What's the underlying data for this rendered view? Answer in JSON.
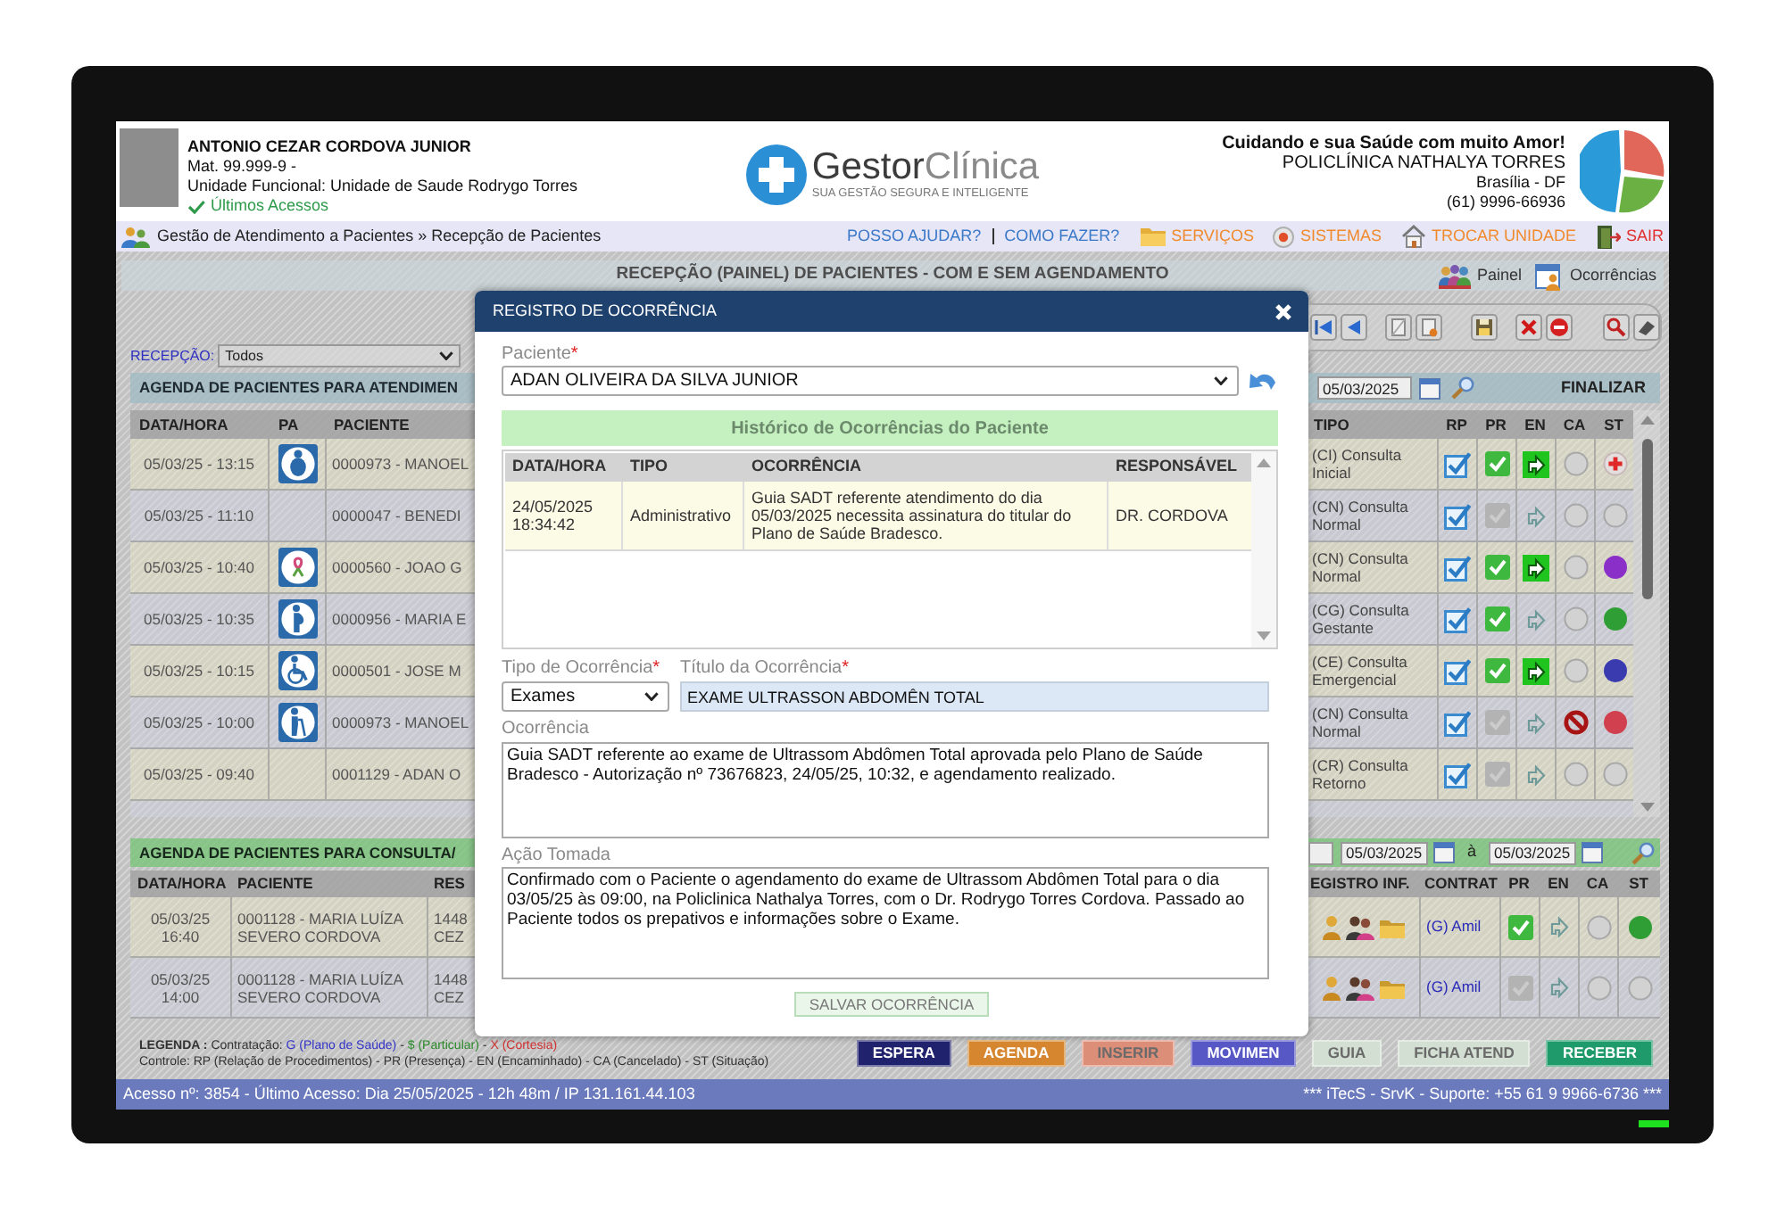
{
  "header": {
    "user": {
      "name": "ANTONIO CEZAR CORDOVA JUNIOR",
      "registration": "Mat. 99.999-9 -",
      "unit": "Unidade Funcional: Unidade de Saude Rodrygo Torres",
      "recent_access": "Últimos Acessos"
    },
    "logo": {
      "name": "**Gestor**Clínica",
      "tagline": "SUA GESTÃO SEGURA E INTELIGENTE"
    },
    "clinic": {
      "slogan": "Cuidando e sua Saúde com muito Amor!",
      "name": "POLICLÍNICA NATHALYA TORRES",
      "city": "Brasília - DF",
      "phone": "(61) 9996-66936"
    }
  },
  "nav": {
    "breadcrumb": "Gestão de Atendimento a Pacientes » Recepção de Pacientes",
    "help_links": [
      "POSSO AJUDAR?",
      "COMO FAZER?"
    ],
    "menu": [
      {
        "label": "SERVIÇOS",
        "kind": "services"
      },
      {
        "label": "SISTEMAS",
        "kind": "systems"
      },
      {
        "label": "TROCAR UNIDADE",
        "kind": "switch_unit"
      },
      {
        "label": "SAIR",
        "kind": "exit"
      }
    ]
  },
  "page": {
    "title": "RECEPÇÃO (PAINEL) DE PACIENTES - COM E SEM AGENDAMENTO",
    "shortcuts": [
      {
        "label": "Painel",
        "kind": "panel"
      },
      {
        "label": "Ocorrências",
        "kind": "occurrences"
      }
    ]
  },
  "reception_filter": {
    "label": "RECEPÇÃO:",
    "value": "Todos"
  },
  "attendance": {
    "title": "AGENDA DE PACIENTES PARA ATENDIMEN",
    "date": "05/03/2025",
    "finalize": "FINALIZAR",
    "columns": [
      "DATA/HORA",
      "PA",
      "PACIENTE",
      "TIPO",
      "RP",
      "PR",
      "EN",
      "CA",
      "ST"
    ],
    "rows": [
      {
        "datetime": "05/03/25 - 13:15",
        "pa": {
          "kind": "obese"
        },
        "patient": "0000973 - MANOEL",
        "type": "(CI) Consulta Inicial",
        "rp": true,
        "present": true,
        "forwarded": true,
        "cancelled": false,
        "status": {
          "kind": "cross"
        }
      },
      {
        "datetime": "05/03/25 - 11:10",
        "patient": "0000047 - BENEDI",
        "type": "(CN) Consulta Normal",
        "rp": true,
        "present": false,
        "forwarded": false,
        "cancelled": false,
        "status": {
          "kind": "empty"
        }
      },
      {
        "datetime": "05/03/25 - 10:40",
        "pa": {
          "kind": "ribbon"
        },
        "patient": "0000560 - JOAO G",
        "type": "(CN) Consulta Normal",
        "rp": true,
        "present": true,
        "forwarded": true,
        "cancelled": false,
        "status": {
          "kind": "dot",
          "color": "#8b2fc9"
        }
      },
      {
        "datetime": "05/03/25 - 10:35",
        "pa": {
          "kind": "pregnant"
        },
        "patient": "0000956 - MARIA E",
        "type": "(CG) Consulta Gestante",
        "rp": true,
        "present": true,
        "forwarded": false,
        "cancelled": false,
        "status": {
          "kind": "dot",
          "color": "#2f9e34"
        }
      },
      {
        "datetime": "05/03/25 - 10:15",
        "pa": {
          "kind": "wheelchair"
        },
        "patient": "0000501 - JOSE M",
        "type": "(CE) Consulta Emergencial",
        "rp": true,
        "present": true,
        "forwarded": true,
        "cancelled": false,
        "status": {
          "kind": "dot",
          "color": "#3b3bb0"
        }
      },
      {
        "datetime": "05/03/25 - 10:00",
        "pa": {
          "kind": "elderly"
        },
        "patient": "0000973 - MANOEL",
        "type": "(CN) Consulta Normal",
        "rp": true,
        "present": false,
        "forwarded": false,
        "cancelled": true,
        "status": {
          "kind": "dot",
          "color": "#d0404e"
        }
      },
      {
        "datetime": "05/03/25 - 09:40",
        "patient": "0001129 - ADAN O",
        "type": "(CR) Consulta Retorno",
        "rp": true,
        "present": false,
        "forwarded": false,
        "cancelled": false,
        "status": {
          "kind": "empty"
        }
      }
    ]
  },
  "consultation": {
    "title": "AGENDA DE PACIENTES PARA CONSULTA/",
    "date_from": "05/03/2025",
    "separator": "à",
    "date_to": "05/03/2025",
    "columns": [
      "DATA/HORA",
      "PACIENTE",
      "RES",
      "EGISTRO INF.",
      "CONTRAT",
      "PR",
      "EN",
      "CA",
      "ST"
    ],
    "rows": [
      {
        "datetime": "05/03/25 16:40",
        "patient": "0001128 - MARIA LUÍZA SEVERO CORDOVA",
        "res": "1448 CEZ",
        "contract": "(G) Amil",
        "present": true,
        "forwarded": false,
        "cancelled": false,
        "status": {
          "kind": "dot",
          "color": "#2f9e34"
        }
      },
      {
        "datetime": "05/03/25 14:00",
        "patient": "0001128 - MARIA LUÍZA SEVERO CORDOVA",
        "res": "1448 CEZ",
        "contract": "(G) Amil",
        "present": false,
        "forwarded": false,
        "cancelled": false,
        "status": {
          "kind": "empty"
        }
      }
    ]
  },
  "legend": {
    "title": "LEGENDA :",
    "parts": [
      {
        "text": "Contratação:"
      },
      {
        "text": "G (Plano de Saúde)",
        "color": "#3232c8"
      },
      {
        "text": "-"
      },
      {
        "text": "$ (Particular)",
        "color": "#2a8a2a"
      },
      {
        "text": "-"
      },
      {
        "text": "X (Cortesia)",
        "color": "#d03030"
      }
    ],
    "control": "Controle: RP (Relação de Procedimentos) - PR (Presença) - EN (Encaminhado) - CA (Cancelado) - ST (Situação)"
  },
  "buttons": [
    {
      "label": "ESPERA",
      "color": "#20226e"
    },
    {
      "label": "AGENDA",
      "color": "#d6862e"
    },
    {
      "label": "INSERIR",
      "color": "#dc8e78"
    },
    {
      "label": "MOVIMEN",
      "color": "#5757c6"
    },
    {
      "label": "GUIA",
      "color": "#d2dfd2"
    },
    {
      "label": "FICHA ATEND",
      "color": "#d2dfd2"
    },
    {
      "label": "RECEBER",
      "color": "#1f9a6b"
    }
  ],
  "status_bar": {
    "left": "Acesso nº: 3854 - Último Acesso: Dia 25/05/2025 - 12h 48m / IP 131.161.44.103",
    "right": "*** iTecS - SrvK - Suporte: +55 61 9 9966-6736 ***"
  },
  "modal": {
    "title": "REGISTRO DE OCORRÊNCIA",
    "patient": {
      "label": "Paciente",
      "required_mark": "*",
      "value": "ADAN OLIVEIRA DA SILVA JUNIOR"
    },
    "history": {
      "title": "Histórico de Ocorrências do Paciente",
      "columns": [
        "DATA/HORA",
        "TIPO",
        "OCORRÊNCIA",
        "RESPONSÁVEL"
      ],
      "rows": [
        {
          "datetime": "24/05/2025 18:34:42",
          "type": "Administrativo",
          "occurrence": "Guia SADT referente atendimento do dia 05/03/2025 necessita assinatura do titular do Plano de Saúde Bradesco.",
          "responsible": "DR. CORDOVA"
        }
      ]
    },
    "occurrence_type": {
      "label": "Tipo de Ocorrência",
      "required_mark": "*",
      "value": "Exames"
    },
    "occurrence_title": {
      "label": "Título da Ocorrência",
      "required_mark": "*",
      "value": "EXAME ULTRASSON ABDOMÊN TOTAL"
    },
    "occurrence": {
      "label": "Ocorrência",
      "value": "Guia SADT referente ao exame de Ultrassom Abdômen Total aprovada pelo Plano de Saúde Bradesco - Autorização nº 73676823, 24/05/25, 10:32, e agendamento realizado."
    },
    "action_taken": {
      "label": "Ação Tomada",
      "value": "Confirmado com o Paciente o agendamento do exame de Ultrassom Abdômen Total para o dia 03/05/25 às 09:00, na Policlinica Nathalya Torres, com o Dr. Rodrygo Torres Cordova. Passado ao Paciente todos os prepativos e informações sobre o Exame."
    },
    "save_button": "SALVAR OCORRÊNCIA"
  }
}
